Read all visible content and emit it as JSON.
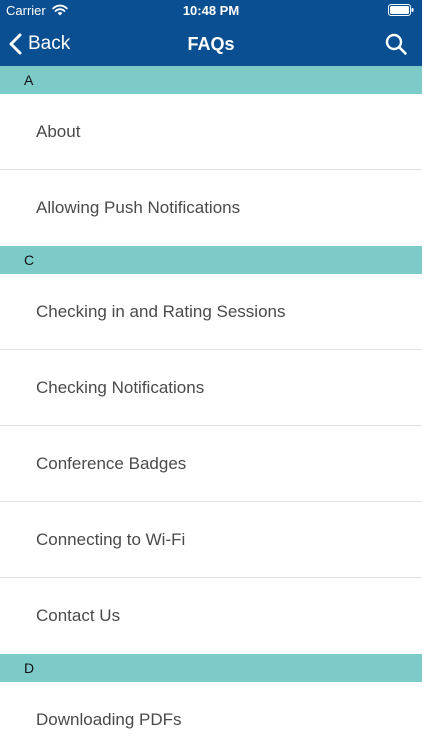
{
  "status_bar": {
    "carrier": "Carrier",
    "time": "10:48 PM"
  },
  "nav": {
    "back_label": "Back",
    "title": "FAQs"
  },
  "colors": {
    "nav_background": "#0a4f91",
    "section_header": "#7ccbc8"
  },
  "sections": [
    {
      "letter": "A",
      "items": [
        "About",
        "Allowing Push Notifications"
      ]
    },
    {
      "letter": "C",
      "items": [
        "Checking in and Rating Sessions",
        "Checking Notifications",
        "Conference Badges",
        "Connecting to Wi-Fi",
        "Contact Us"
      ]
    },
    {
      "letter": "D",
      "items": [
        "Downloading PDFs"
      ]
    }
  ]
}
